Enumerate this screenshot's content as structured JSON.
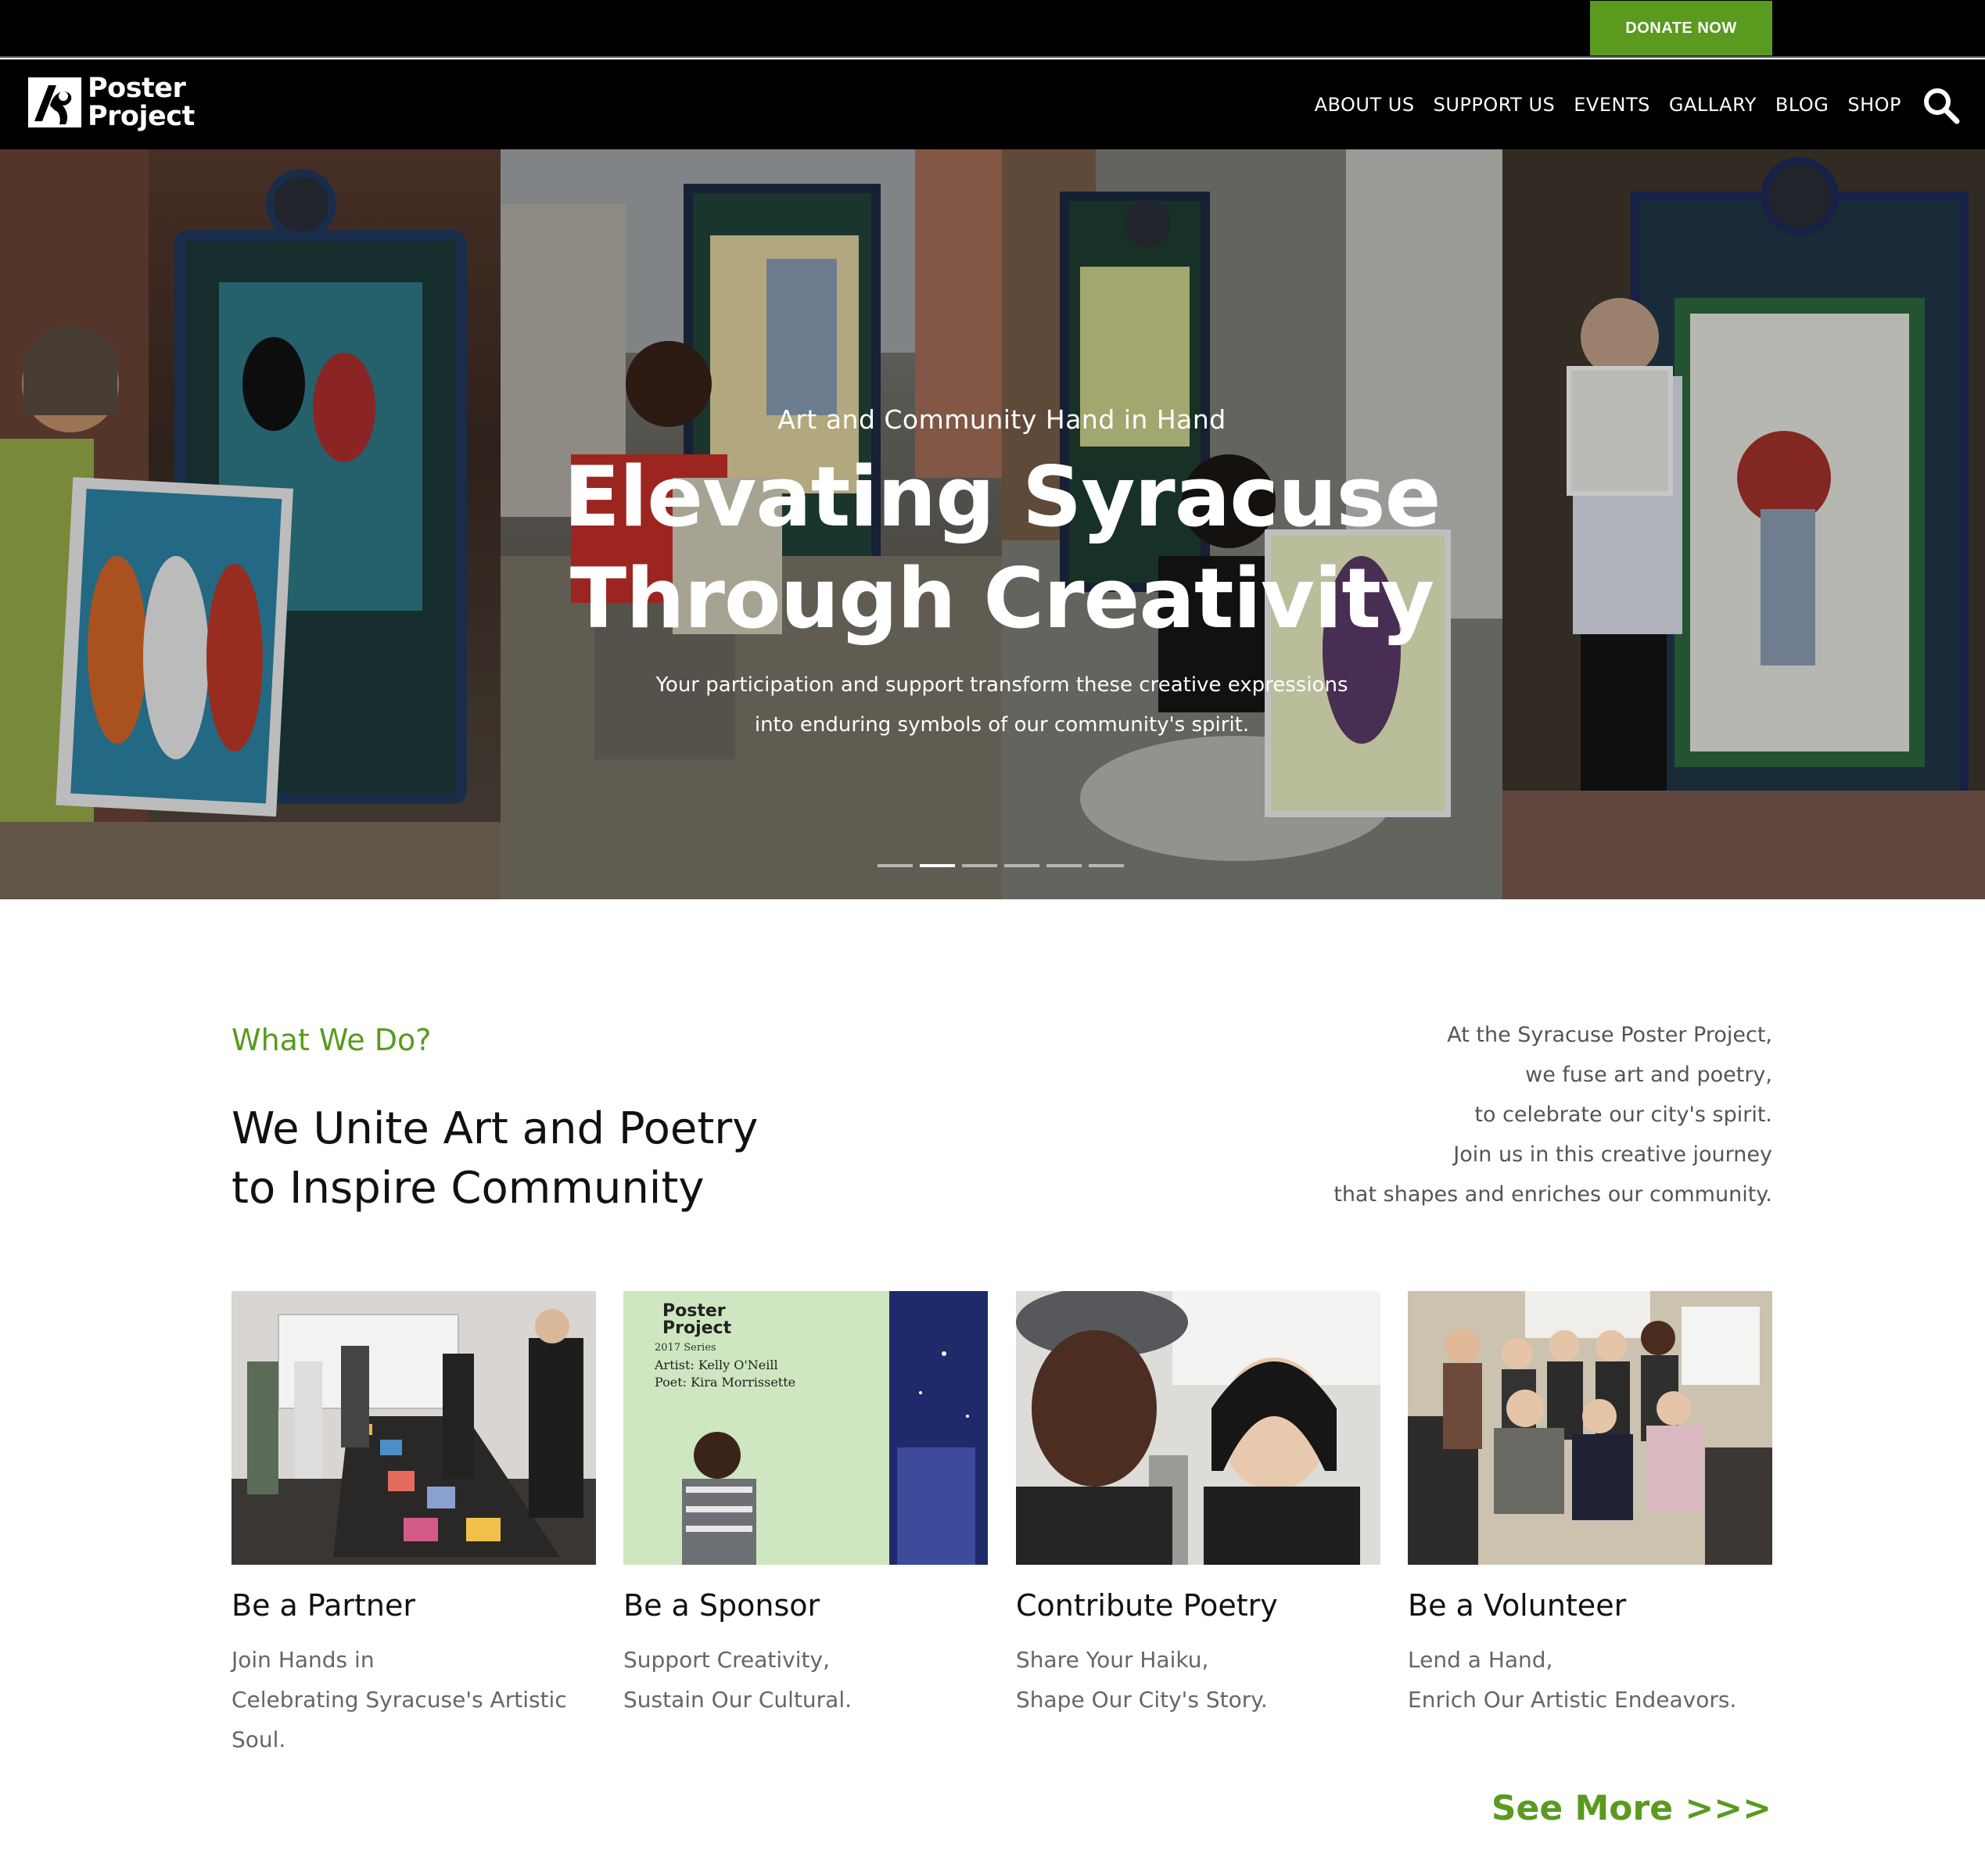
{
  "topbar": {
    "donate_label": "DONATE NOW"
  },
  "brand": {
    "line1": "Poster",
    "line2": "Project"
  },
  "nav": {
    "items": [
      "ABOUT US",
      "SUPPORT US",
      "EVENTS",
      "GALLARY",
      "BLOG",
      "SHOP"
    ]
  },
  "hero": {
    "subtitle": "Art and Community Hand in Hand",
    "title_line1": "Elevating Syracuse",
    "title_line2": "Through Creativity",
    "text_line1": "Your participation and support transform these creative expressions",
    "text_line2": "into enduring symbols of our community's spirit.",
    "active_slide": 2,
    "slide_count": 6
  },
  "what_we_do": {
    "eyebrow": "What We Do?",
    "title_line1": "We Unite Art and Poetry",
    "title_line2": "to Inspire Community",
    "body": [
      "At the Syracuse Poster Project,",
      "we fuse art and poetry,",
      "to celebrate our city's spirit.",
      "Join us in this creative journey",
      "that shapes and enriches our community."
    ]
  },
  "cards": [
    {
      "title": "Be a Partner",
      "text": [
        "Join Hands in",
        "Celebrating Syracuse's Artistic",
        "Soul."
      ]
    },
    {
      "title": "Be a Sponsor",
      "text": [
        "Support Creativity,",
        "Sustain Our Cultural."
      ],
      "poster": {
        "brand1": "Poster",
        "brand2": "Project",
        "series": "2017 Series",
        "artist": "Artist: Kelly O'Neill",
        "poet": "Poet: Kira Morrissette"
      }
    },
    {
      "title": "Contribute Poetry",
      "text": [
        "Share Your Haiku,",
        "Shape Our City's Story."
      ]
    },
    {
      "title": "Be a Volunteer",
      "text": [
        "Lend a Hand,",
        "Enrich Our Artistic Endeavors."
      ]
    }
  ],
  "see_more_label": "See More >>>",
  "colors": {
    "accent": "#5a9a1f",
    "nav_bg": "#000000"
  }
}
